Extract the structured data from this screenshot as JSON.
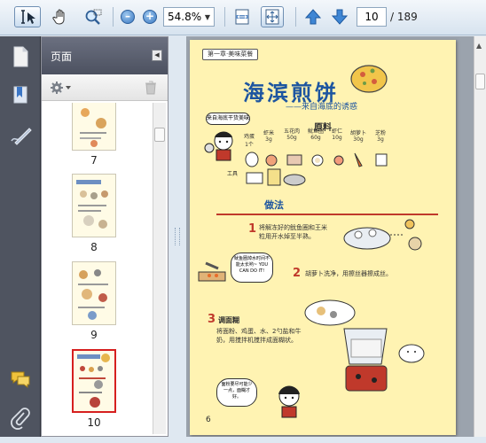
{
  "toolbar": {
    "zoom_value": "54.8%",
    "current_page": "10",
    "page_total": "/ 189"
  },
  "panel": {
    "title": "页面",
    "thumbnails": [
      {
        "label": "7"
      },
      {
        "label": "8"
      },
      {
        "label": "9"
      },
      {
        "label": "10"
      }
    ]
  },
  "document": {
    "header_tag": "第一章·美味菜餐",
    "title": "海滨煎饼",
    "subtitle": "——来自海底的诱惑",
    "speech_intro": "来自海底干货美味",
    "ingredients_label": "原料",
    "ingredients": [
      {
        "name": "鸡蛋",
        "amount": "1个"
      },
      {
        "name": "虾米",
        "amount": "3g"
      },
      {
        "name": "五花肉",
        "amount": "50g"
      },
      {
        "name": "鱿鱼圈",
        "amount": "60g"
      },
      {
        "name": "虾仁",
        "amount": "10g"
      },
      {
        "name": "胡萝卜",
        "amount": "30g"
      },
      {
        "name": "芝粉",
        "amount": "3g"
      }
    ],
    "tool_label": "工具",
    "method_label": "做法",
    "step1": "将解冻好的鱿鱼圈和王米粒用开水焯至半熟。",
    "bubble_text": "鱿鱼圈焯水时间不能太长哟~ YOU CAN DO IT!",
    "step2": "胡萝卜洗净，用擦丝器擦成丝。",
    "step3_title": "调面糊",
    "step3": "将面粉、鸡蛋、水、2勺盐和牛奶，用搅拌机搅拌成面糊状。",
    "bubble_bottom": "面粉要尽可能少一点，面糊才好。",
    "page_number": "6"
  }
}
